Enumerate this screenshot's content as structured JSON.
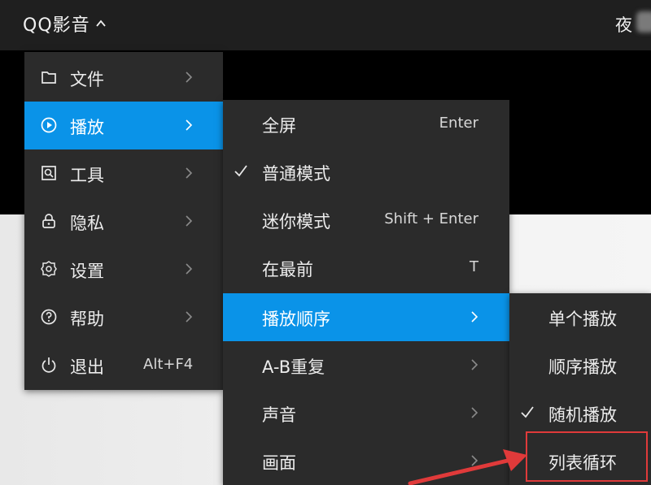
{
  "app": {
    "title": "QQ影音",
    "night_label": "夜"
  },
  "main_menu": {
    "items": [
      {
        "label": "文件",
        "icon": "folder-icon",
        "has_submenu": true
      },
      {
        "label": "播放",
        "icon": "play-circle-icon",
        "has_submenu": true,
        "active": true
      },
      {
        "label": "工具",
        "icon": "tools-icon",
        "has_submenu": true
      },
      {
        "label": "隐私",
        "icon": "lock-icon",
        "has_submenu": true
      },
      {
        "label": "设置",
        "icon": "gear-icon",
        "has_submenu": true
      },
      {
        "label": "帮助",
        "icon": "help-icon",
        "has_submenu": true
      },
      {
        "label": "退出",
        "icon": "power-icon",
        "shortcut": "Alt+F4"
      }
    ]
  },
  "play_menu": {
    "items": [
      {
        "label": "全屏",
        "shortcut": "Enter"
      },
      {
        "label": "普通模式",
        "checked": true
      },
      {
        "label": "迷你模式",
        "shortcut": "Shift + Enter"
      },
      {
        "label": "在最前",
        "shortcut": "T"
      },
      {
        "label": "播放顺序",
        "has_submenu": true,
        "active": true
      },
      {
        "label": "A-B重复",
        "has_submenu": true
      },
      {
        "label": "声音",
        "has_submenu": true
      },
      {
        "label": "画面",
        "has_submenu": true
      }
    ]
  },
  "order_menu": {
    "items": [
      {
        "label": "单个播放"
      },
      {
        "label": "顺序播放"
      },
      {
        "label": "随机播放",
        "checked": true
      },
      {
        "label": "列表循环",
        "highlighted": true
      }
    ]
  },
  "colors": {
    "menu_bg": "#2b2b2b",
    "active_bg": "#0a93e8",
    "annotation_red": "#e03a3a"
  }
}
